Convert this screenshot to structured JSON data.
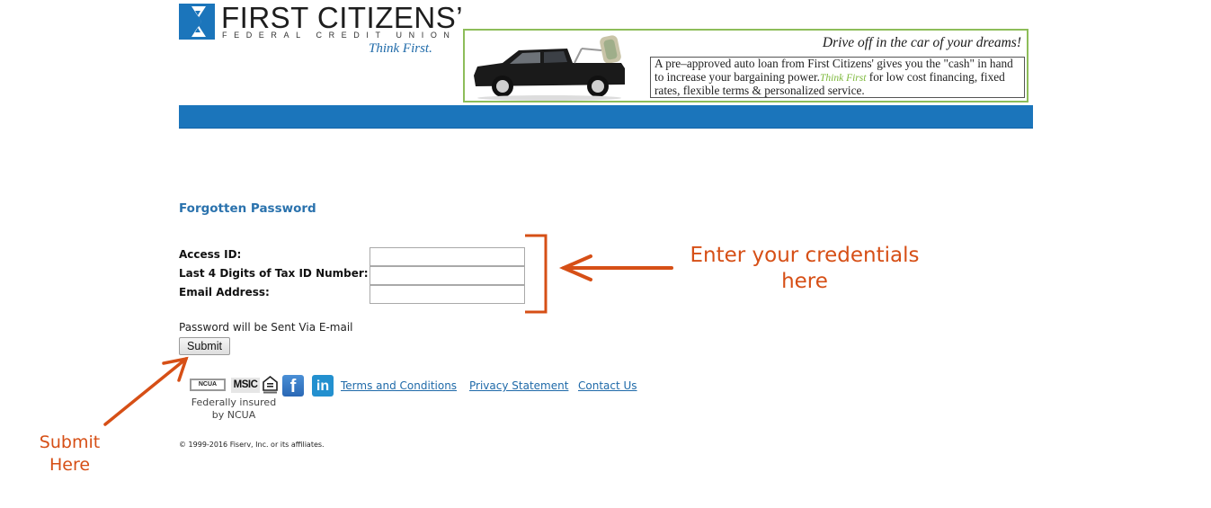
{
  "header": {
    "logo": {
      "name": "FIRST CITIZENS’",
      "subtitle": "FEDERAL CREDIT UNION",
      "tagline": "Think First.",
      "brand_color": "#1b75bb"
    },
    "banner": {
      "headline": "Drive off in the car of your dreams!",
      "body_before": "A pre–approved auto loan from First Citizens' gives you the \"cash\" in hand to increase your bargaining power.",
      "body_highlight": "Think First",
      "body_after": " for low cost financing, fixed rates, flexible terms & personalized service.",
      "border_color": "#8dbd5a",
      "highlight_color": "#7cb83a"
    }
  },
  "form": {
    "title": "Forgotten Password",
    "fields": [
      {
        "label": "Access ID:",
        "value": ""
      },
      {
        "label": "Last 4 Digits of Tax ID Number:",
        "value": ""
      },
      {
        "label": "Email Address:",
        "value": ""
      }
    ],
    "note": "Password will be Sent Via E-mail",
    "submit_label": "Submit"
  },
  "footer": {
    "badges": {
      "ncua": "NCUA",
      "msic": "MSIC",
      "equal_housing": "equal-housing-icon"
    },
    "social": {
      "facebook": "f",
      "linkedin": "in"
    },
    "links": [
      "Terms and Conditions",
      "Privacy Statement",
      "Contact Us"
    ],
    "insured_text": "Federally insured by NCUA",
    "copyright": "© 1999-2016 Fiserv, Inc. or its affiliates."
  },
  "annotations": {
    "credentials": "Enter your credentials here",
    "submit": "Submit Here",
    "color": "#d64f16"
  }
}
